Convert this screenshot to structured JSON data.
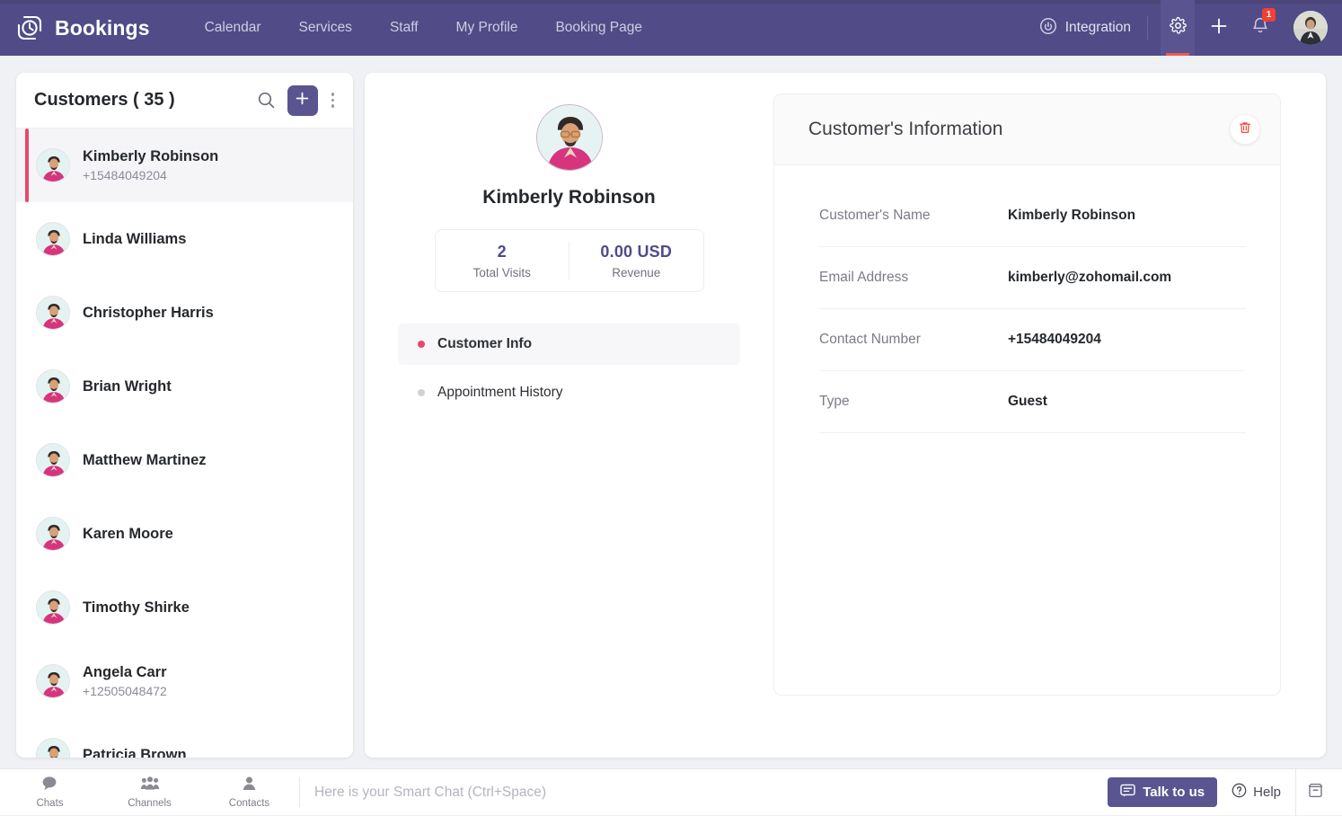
{
  "topbar": {
    "brand": "Bookings",
    "brand_icon": "bookings-clock-logo-icon",
    "nav": [
      {
        "label": "Calendar"
      },
      {
        "label": "Services"
      },
      {
        "label": "Staff"
      },
      {
        "label": "My Profile"
      },
      {
        "label": "Booking Page"
      }
    ],
    "integration_label": "Integration",
    "integration_icon": "integration-plug-icon",
    "settings_icon": "gear-icon",
    "add_icon": "plus-icon",
    "notifications_icon": "bell-icon",
    "notification_count": "1",
    "avatar_icon": "user-avatar-photo",
    "bg_color": "#514b87",
    "active_underline_color": "#f05a4f",
    "badge_color": "#ef4136"
  },
  "customers_panel": {
    "title": "Customers ( 35 )",
    "search_icon": "search-icon",
    "add_icon": "plus-icon",
    "more_icon": "kebab-menu-icon",
    "accent_color": "#5a5490",
    "selected_marker_color": "#e8476f",
    "items": [
      {
        "name": "Kimberly Robinson",
        "phone": "+15484049204",
        "selected": true
      },
      {
        "name": "Linda Williams",
        "phone": "",
        "selected": false
      },
      {
        "name": "Christopher Harris",
        "phone": "",
        "selected": false
      },
      {
        "name": "Brian Wright",
        "phone": "",
        "selected": false
      },
      {
        "name": "Matthew Martinez",
        "phone": "",
        "selected": false
      },
      {
        "name": "Karen Moore",
        "phone": "",
        "selected": false
      },
      {
        "name": "Timothy Shirke",
        "phone": "",
        "selected": false
      },
      {
        "name": "Angela Carr",
        "phone": "+12505048472",
        "selected": false
      },
      {
        "name": "Patricia Brown",
        "phone": "",
        "selected": false
      }
    ]
  },
  "profile": {
    "avatar_icon": "customer-avatar-illustration",
    "name": "Kimberly Robinson",
    "stats": [
      {
        "value": "2",
        "label": "Total Visits"
      },
      {
        "value": "0.00 USD",
        "label": "Revenue"
      }
    ],
    "stat_value_color": "#4f4a8c",
    "tabs": [
      {
        "label": "Customer Info",
        "active": true
      },
      {
        "label": "Appointment History",
        "active": false
      }
    ]
  },
  "info_card": {
    "title": "Customer's Information",
    "delete_icon": "trash-icon",
    "delete_icon_color": "#ef4136",
    "rows": [
      {
        "label": "Customer's Name",
        "value": "Kimberly Robinson"
      },
      {
        "label": "Email Address",
        "value": "kimberly@zohomail.com"
      },
      {
        "label": "Contact Number",
        "value": "+15484049204"
      },
      {
        "label": "Type",
        "value": "Guest"
      }
    ]
  },
  "bottombar": {
    "tabs": [
      {
        "label": "Chats",
        "icon": "chat-bubble-icon"
      },
      {
        "label": "Channels",
        "icon": "channels-group-icon"
      },
      {
        "label": "Contacts",
        "icon": "contact-person-icon"
      }
    ],
    "smartchat_placeholder": "Here is your Smart Chat (Ctrl+Space)",
    "talk_label": "Talk to us",
    "talk_icon": "chat-message-icon",
    "help_label": "Help",
    "help_icon": "question-circle-icon",
    "archive_icon": "archive-box-icon",
    "talk_bg_color": "#5a5490"
  }
}
